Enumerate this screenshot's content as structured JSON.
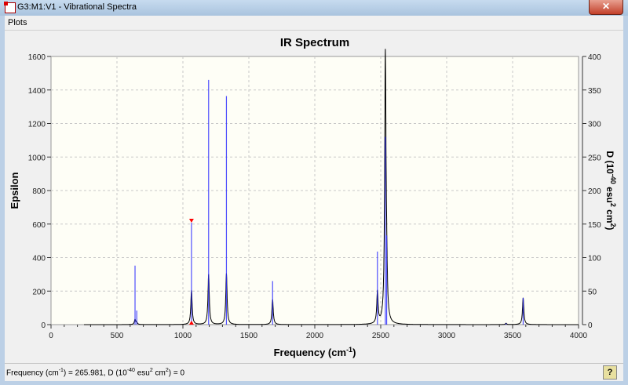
{
  "window": {
    "title": "G3:M1:V1 - Vibrational Spectra",
    "close_label": "✕"
  },
  "menu": {
    "plots_label": "Plots"
  },
  "status": {
    "text_parts": [
      "Frequency (cm",
      "-1",
      ") = 265.981, D (10",
      "-40",
      " esu",
      "2",
      " cm",
      "2",
      ") = 0"
    ]
  },
  "colors": {
    "plot_bg": "#fefef6",
    "spectrum": "#000000",
    "sticks": "#3030ff",
    "marker": "#ff0000",
    "grid": "#c8c8c8"
  },
  "chart_data": {
    "type": "line",
    "title": "IR Spectrum",
    "xlabel": "Frequency (cm-1)",
    "xlabel_parts": [
      "Frequency (cm",
      "-1",
      ")"
    ],
    "ylabel": "Epsilon",
    "y2label": "D (10-40 esu2 cm2)",
    "y2label_parts": [
      "D (10",
      "-40",
      " esu",
      "2",
      " cm",
      "2",
      ")"
    ],
    "xlim": [
      0,
      4000
    ],
    "ylim": [
      0,
      1600
    ],
    "y2lim": [
      0,
      400
    ],
    "xticks": [
      0,
      500,
      1000,
      1500,
      2000,
      2500,
      3000,
      3500,
      4000
    ],
    "yticks": [
      0,
      200,
      400,
      600,
      800,
      1000,
      1200,
      1400,
      1600
    ],
    "y2ticks": [
      0,
      50,
      100,
      150,
      200,
      250,
      300,
      350,
      400
    ],
    "grid": true,
    "spectrum_range": [
      250,
      4000
    ],
    "peaks": [
      {
        "freq": 637,
        "epsilon": 30,
        "D": 88
      },
      {
        "freq": 650,
        "epsilon": 12,
        "D": 21
      },
      {
        "freq": 1065,
        "epsilon": 205,
        "D": 152
      },
      {
        "freq": 1195,
        "epsilon": 300,
        "D": 365
      },
      {
        "freq": 1330,
        "epsilon": 305,
        "D": 341
      },
      {
        "freq": 1680,
        "epsilon": 150,
        "D": 65
      },
      {
        "freq": 2475,
        "epsilon": 190,
        "D": 109
      },
      {
        "freq": 2535,
        "epsilon": 1590,
        "D": 280
      },
      {
        "freq": 2545,
        "epsilon": 200,
        "D": 133
      },
      {
        "freq": 3450,
        "epsilon": 8,
        "D": 2
      },
      {
        "freq": 3580,
        "epsilon": 160,
        "D": 40
      }
    ],
    "selected_freq": 1065
  }
}
